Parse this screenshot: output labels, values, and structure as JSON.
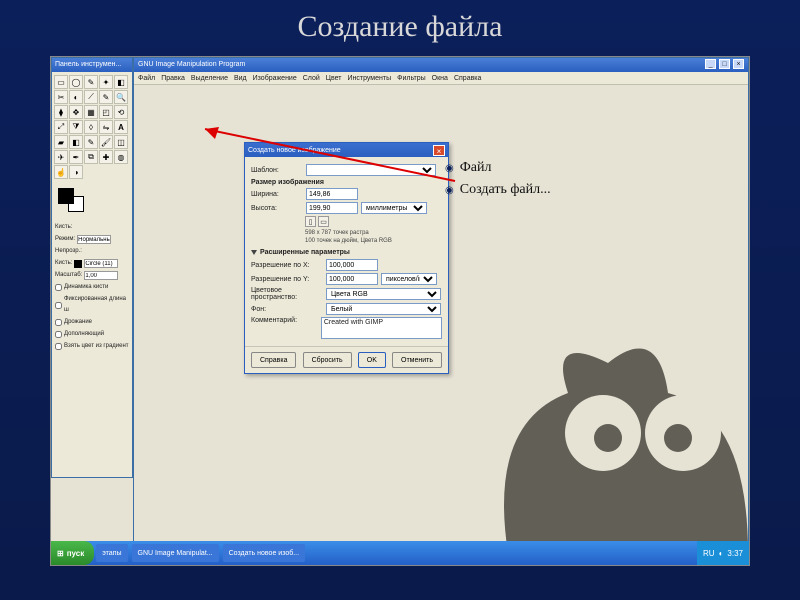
{
  "slide_title": "Создание файла",
  "bullets": [
    "Файл",
    "Создать файл..."
  ],
  "toolbox": {
    "title": "Панель инструмен..."
  },
  "brush_options": {
    "label_brush": "Кисть:",
    "label_mode": "Режим:",
    "mode_value": "Нормальный",
    "label_opacity": "Непрозр.:",
    "label_brush2": "Кисть:",
    "brush_name": "Circle (11)",
    "label_scale": "Масштаб:",
    "scale_value": "1,00",
    "cb_dynamics": "Динамика кисти",
    "cb_fade": "Фиксированная длина ш",
    "cb_jitter": "Дрожание",
    "cb_incremental": "Дополняющий",
    "cb_gradient": "Взять цвет из градиент"
  },
  "main_window": {
    "title": "GNU Image Manipulation Program",
    "menu": [
      "Файл",
      "Правка",
      "Выделение",
      "Вид",
      "Изображение",
      "Слой",
      "Цвет",
      "Инструменты",
      "Фильтры",
      "Окна",
      "Справка"
    ]
  },
  "dialog": {
    "title": "Создать новое изображение",
    "template_label": "Шаблон:",
    "size_group": "Размер изображения",
    "width_label": "Ширина:",
    "width_value": "149,86",
    "height_label": "Высота:",
    "height_value": "199,90",
    "units_value": "миллиметры",
    "info_line1": "598 x 787 точек растра",
    "info_line2": "100 точек на дюйм, Цвета RGB",
    "adv_label": "Расширенные параметры",
    "xres_label": "Разрешение по X:",
    "xres_value": "100,000",
    "yres_label": "Разрешение по Y:",
    "yres_value": "100,000",
    "res_units": "пикселов/in",
    "colorspace_label": "Цветовое пространство:",
    "colorspace_value": "Цвета RGB",
    "fill_label": "Фон:",
    "fill_value": "Белый",
    "comment_label": "Комментарий:",
    "comment_value": "Created with GIMP",
    "btn_help": "Справка",
    "btn_reset": "Сбросить",
    "btn_ok": "OK",
    "btn_cancel": "Отменить"
  },
  "taskbar": {
    "start": "пуск",
    "items": [
      "этапы",
      "GNU Image Manipulat...",
      "Создать новое изоб..."
    ],
    "lang": "RU",
    "time": "3:37"
  }
}
